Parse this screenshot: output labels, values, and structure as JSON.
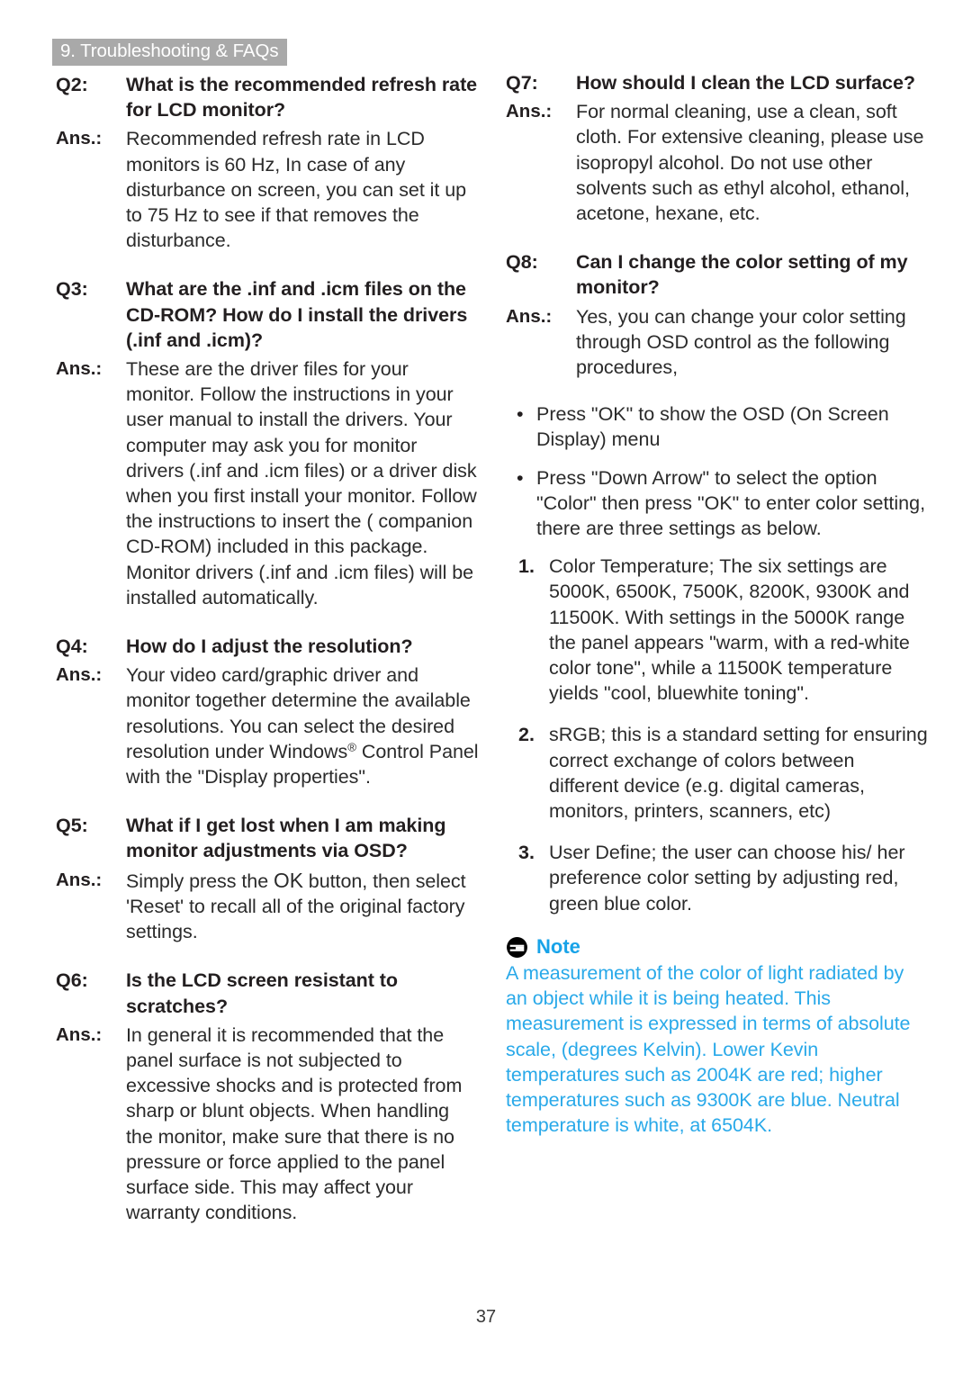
{
  "header": {
    "chapter_label": "9. Troubleshooting & FAQs",
    "band_color": "#a9a9a9",
    "band_text_color": "#ffffff"
  },
  "folio": {
    "page_number": "37"
  },
  "left_column": {
    "entries": [
      {
        "q_label": "Q2:",
        "question": "What is the recommended refresh rate for LCD monitor?",
        "a_label": "Ans.:",
        "answer": "Recommended refresh rate in LCD monitors is 60 Hz, In case of any disturbance on screen, you can set it up to 75 Hz to see if that removes the disturbance."
      },
      {
        "q_label": "Q3:",
        "question": "What are the .inf and .icm files on the CD-ROM? How do I install the drivers (.inf and .icm)?",
        "a_label": "Ans.:",
        "answer": "These are the driver files for your monitor. Follow the instructions in your user manual to install the drivers. Your computer may ask you for monitor drivers (.inf and .icm files) or a driver disk when you first install your monitor. Follow the instructions to insert the ( companion CD-ROM) included in this package. Monitor drivers (.inf and .icm files) will be installed automatically."
      },
      {
        "q_label": "Q4:",
        "question": "How do I adjust the resolution?",
        "a_label": "Ans.:",
        "answer_part1": "Your video card/graphic driver and monitor together determine the available resolutions. You can select the desired resolution under Windows",
        "answer_sup": "®",
        "answer_part2": " Control Panel with the \"Display properties\"."
      },
      {
        "q_label": "Q5:",
        "question": "What if I get lost when I am making monitor adjustments via OSD?",
        "a_label": "Ans.:",
        "answer_part1": "Simply press the ",
        "answer_ok": "OK",
        "answer_part2": " button, then select 'Reset' to recall all of the original factory settings."
      },
      {
        "q_label": "Q6:",
        "question": "Is the LCD screen resistant to scratches?",
        "a_label": "Ans.:",
        "answer": "In general it is recommended that the panel surface is not subjected to excessive shocks and is protected from sharp or blunt objects. When handling the monitor, make sure that there is no pressure or force applied to the panel surface side. This may affect your warranty conditions."
      }
    ]
  },
  "right_column": {
    "entries": [
      {
        "q_label": "Q7:",
        "question": "How should I clean the LCD surface?",
        "a_label": "Ans.:",
        "answer": "For normal cleaning, use a clean, soft cloth. For extensive cleaning, please use isopropyl alcohol. Do not use other solvents such as ethyl alcohol, ethanol, acetone, hexane, etc."
      },
      {
        "q_label": "Q8:",
        "question": "Can I change the color setting of my monitor?",
        "a_label": "Ans.:",
        "answer": "Yes, you can change your color setting through OSD control as the following procedures,"
      }
    ],
    "bullets": [
      {
        "marker": "•",
        "text": "Press \"OK\" to show the OSD (On Screen Display) menu"
      },
      {
        "marker": "•",
        "text": "Press \"Down Arrow\" to select the option \"Color\" then press \"OK\" to enter color setting, there are three settings as below."
      }
    ],
    "numbered": [
      {
        "marker": "1.",
        "text": "Color Temperature; The six settings are 5000K, 6500K, 7500K, 8200K, 9300K and 11500K. With settings in the 5000K range the panel appears \"warm, with a red-white color tone\", while a 11500K temperature yields \"cool, bluewhite toning\"."
      },
      {
        "marker": "2.",
        "text": "sRGB; this is a standard setting for ensuring correct exchange of colors between different device (e.g. digital cameras, monitors, printers, scanners, etc)"
      },
      {
        "marker": "3.",
        "text": "User Define; the user can choose his/ her preference color setting by adjusting red, green blue color."
      }
    ],
    "note": {
      "icon": "note-icon",
      "title": "Note",
      "title_color": "#18a3e8",
      "body_color": "#29a9e9",
      "body": "A measurement of the color of light radiated by an object while it is being heated. This measurement is expressed in terms of absolute scale, (degrees Kelvin). Lower Kevin temperatures such as 2004K are red; higher temperatures such as 9300K are blue. Neutral temperature is white, at 6504K."
    }
  }
}
